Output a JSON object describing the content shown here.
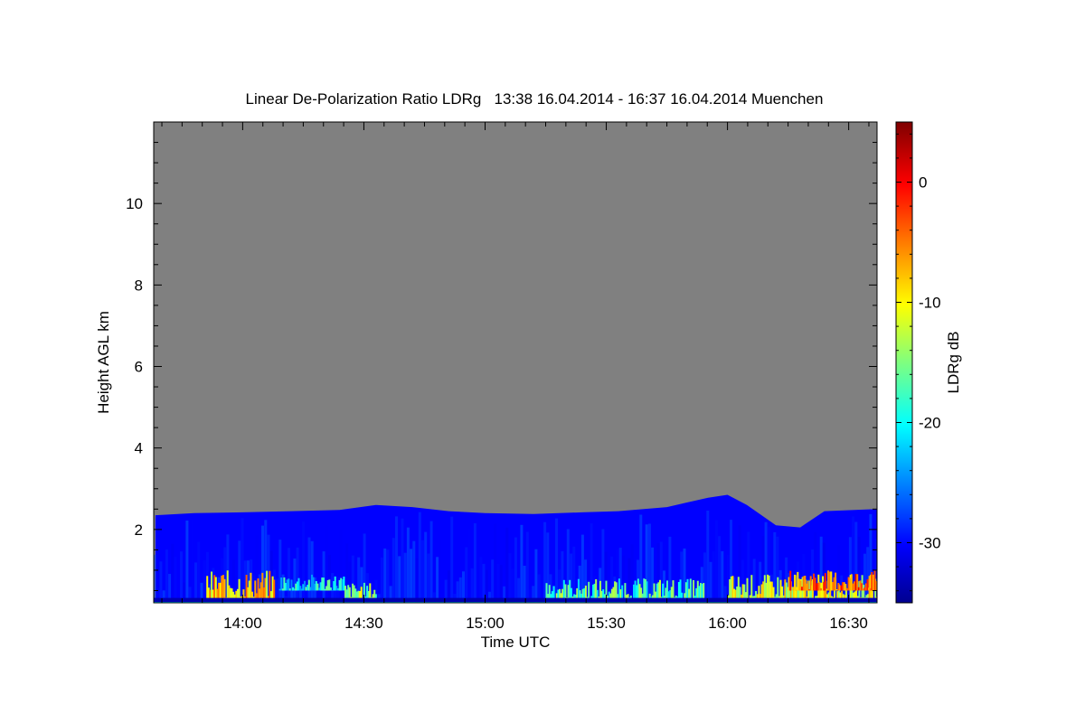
{
  "chart_data": {
    "type": "heatmap",
    "title": "Linear De-Polarization Ratio LDRg   13:38 16.04.2014 - 16:37 16.04.2014 Muenchen",
    "xlabel": "Time UTC",
    "ylabel": "Height AGL km",
    "xlim_hours": [
      13.633,
      16.617
    ],
    "ylim": [
      0.2,
      12.0
    ],
    "x_ticks": [
      {
        "label": "14:00",
        "value": 14.0
      },
      {
        "label": "14:30",
        "value": 14.5
      },
      {
        "label": "15:00",
        "value": 15.0
      },
      {
        "label": "15:30",
        "value": 15.5
      },
      {
        "label": "16:00",
        "value": 16.0
      },
      {
        "label": "16:30",
        "value": 16.5
      }
    ],
    "y_ticks": [
      {
        "label": "2",
        "value": 2
      },
      {
        "label": "4",
        "value": 4
      },
      {
        "label": "6",
        "value": 6
      },
      {
        "label": "8",
        "value": 8
      },
      {
        "label": "10",
        "value": 10
      }
    ],
    "colorbar": {
      "label": "LDRg dB",
      "range": [
        -35,
        5
      ],
      "ticks": [
        {
          "label": "0",
          "value": 0
        },
        {
          "label": "-10",
          "value": -10
        },
        {
          "label": "-20",
          "value": -20
        },
        {
          "label": "-30",
          "value": -30
        }
      ],
      "colormap": "jet"
    },
    "background_color": "#808080",
    "signal_top_km": [
      [
        13.64,
        2.35
      ],
      [
        13.8,
        2.4
      ],
      [
        14.0,
        2.42
      ],
      [
        14.2,
        2.45
      ],
      [
        14.4,
        2.48
      ],
      [
        14.55,
        2.6
      ],
      [
        14.7,
        2.55
      ],
      [
        14.85,
        2.45
      ],
      [
        15.0,
        2.4
      ],
      [
        15.2,
        2.38
      ],
      [
        15.4,
        2.42
      ],
      [
        15.55,
        2.45
      ],
      [
        15.75,
        2.55
      ],
      [
        15.92,
        2.78
      ],
      [
        16.0,
        2.85
      ],
      [
        16.08,
        2.6
      ],
      [
        16.2,
        2.1
      ],
      [
        16.3,
        2.05
      ],
      [
        16.4,
        2.45
      ],
      [
        16.617,
        2.5
      ]
    ],
    "regions": [
      {
        "t0": 13.85,
        "t1": 14.13,
        "h0": 0.3,
        "h1": 1.0,
        "ldr": -8
      },
      {
        "t0": 14.15,
        "t1": 14.42,
        "h0": 0.5,
        "h1": 0.9,
        "ldr": -20
      },
      {
        "t0": 14.42,
        "t1": 14.55,
        "h0": 0.3,
        "h1": 0.7,
        "ldr": -14
      },
      {
        "t0": 15.25,
        "t1": 15.9,
        "h0": 0.3,
        "h1": 0.8,
        "ldr": -17
      },
      {
        "t0": 16.0,
        "t1": 16.617,
        "h0": 0.3,
        "h1": 0.9,
        "ldr": -11
      },
      {
        "t0": 16.25,
        "t1": 16.617,
        "h0": 0.5,
        "h1": 1.0,
        "ldr": -4
      }
    ]
  }
}
